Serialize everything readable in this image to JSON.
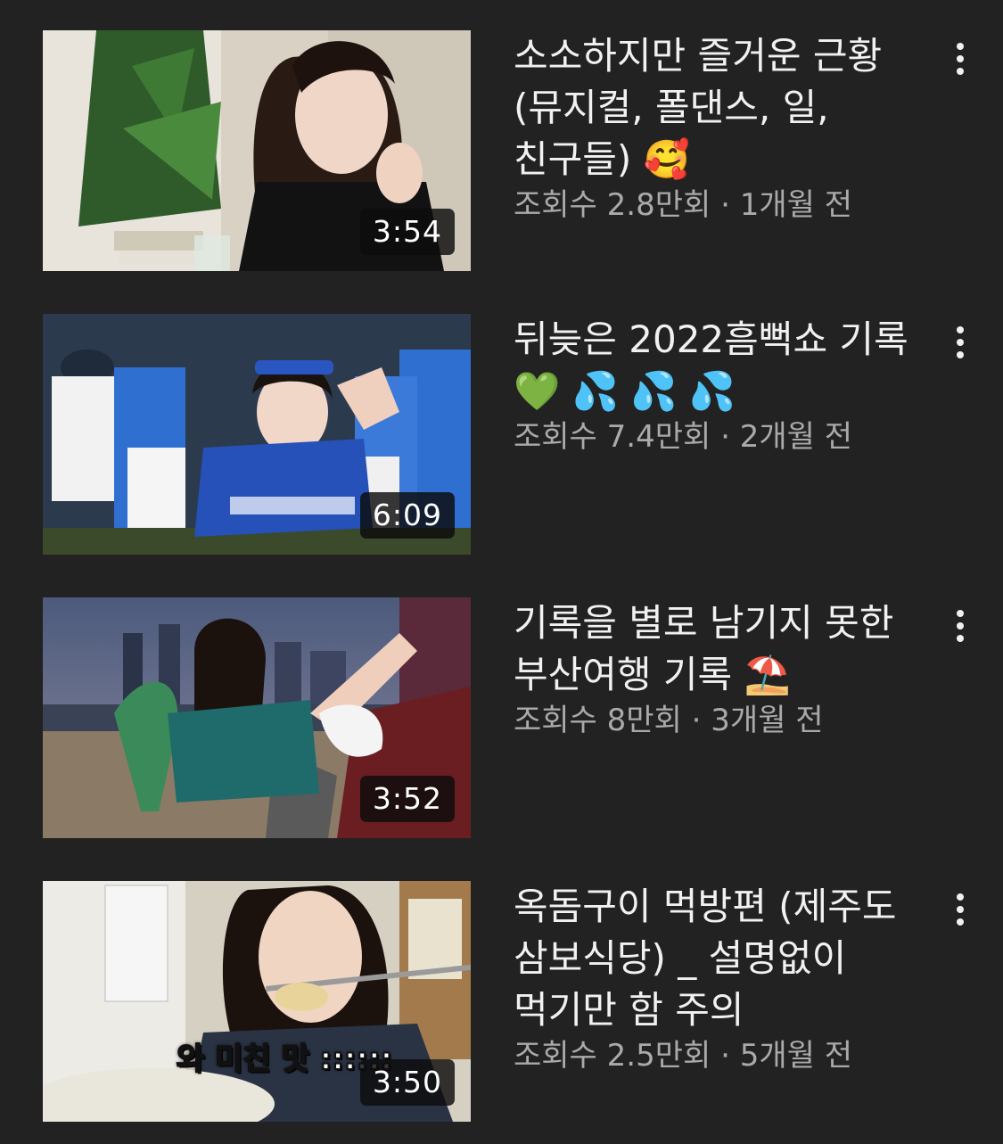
{
  "videos": [
    {
      "title": "소소하지만 즐거운 근황 (뮤지컬, 폴댄스, 일, 친구들) 🥰",
      "views": "조회수 2.8만회",
      "separator": "·",
      "age": "1개월 전",
      "duration": "3:54"
    },
    {
      "title": "뒤늦은 2022흠뻑쇼 기록💚 💦 💦 💦",
      "views": "조회수 7.4만회",
      "separator": "·",
      "age": "2개월 전",
      "duration": "6:09"
    },
    {
      "title": "기록을 별로 남기지 못한 부산여행 기록 ⛱️",
      "views": "조회수 8만회",
      "separator": "·",
      "age": "3개월 전",
      "duration": "3:52"
    },
    {
      "title": "옥돔구이 먹방편 (제주도 삼보식당) _ 설명없이 먹기만 함 주의",
      "views": "조회수 2.5만회",
      "separator": "·",
      "age": "5개월 전",
      "duration": "3:50",
      "thumbnail_caption": "와 미친 맛 ::::::"
    }
  ],
  "colors": {
    "background": "#222222",
    "title": "#f1f1f1",
    "meta": "#aaaaaa"
  },
  "icons": {
    "more": "more-vert-icon"
  }
}
